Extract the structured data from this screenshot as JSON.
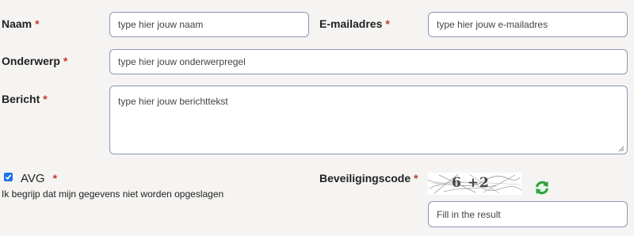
{
  "form": {
    "name": {
      "label": "Naam",
      "required_mark": "*",
      "placeholder": "type hier jouw naam"
    },
    "email": {
      "label": "E-mailadres",
      "required_mark": "*",
      "placeholder": "type hier jouw e-mailadres"
    },
    "subject": {
      "label": "Onderwerp",
      "required_mark": "*",
      "placeholder": "type hier jouw onderwerpregel"
    },
    "message": {
      "label": "Bericht",
      "required_mark": "*",
      "placeholder": "type hier jouw berichttekst"
    },
    "avg": {
      "label": "AVG",
      "required_mark": "*",
      "checked": true,
      "description": "Ik begrijp dat mijn gegevens niet worden opgeslagen"
    },
    "security": {
      "label": "Beveiligingscode",
      "required_mark": "*",
      "captcha_text": "6 +2",
      "placeholder": "Fill in the result"
    }
  },
  "colors": {
    "required": "#c0392b",
    "field_border": "#8f96b8",
    "checkbox": "#1a73e8",
    "refresh_icon": "#2e9e3e"
  }
}
